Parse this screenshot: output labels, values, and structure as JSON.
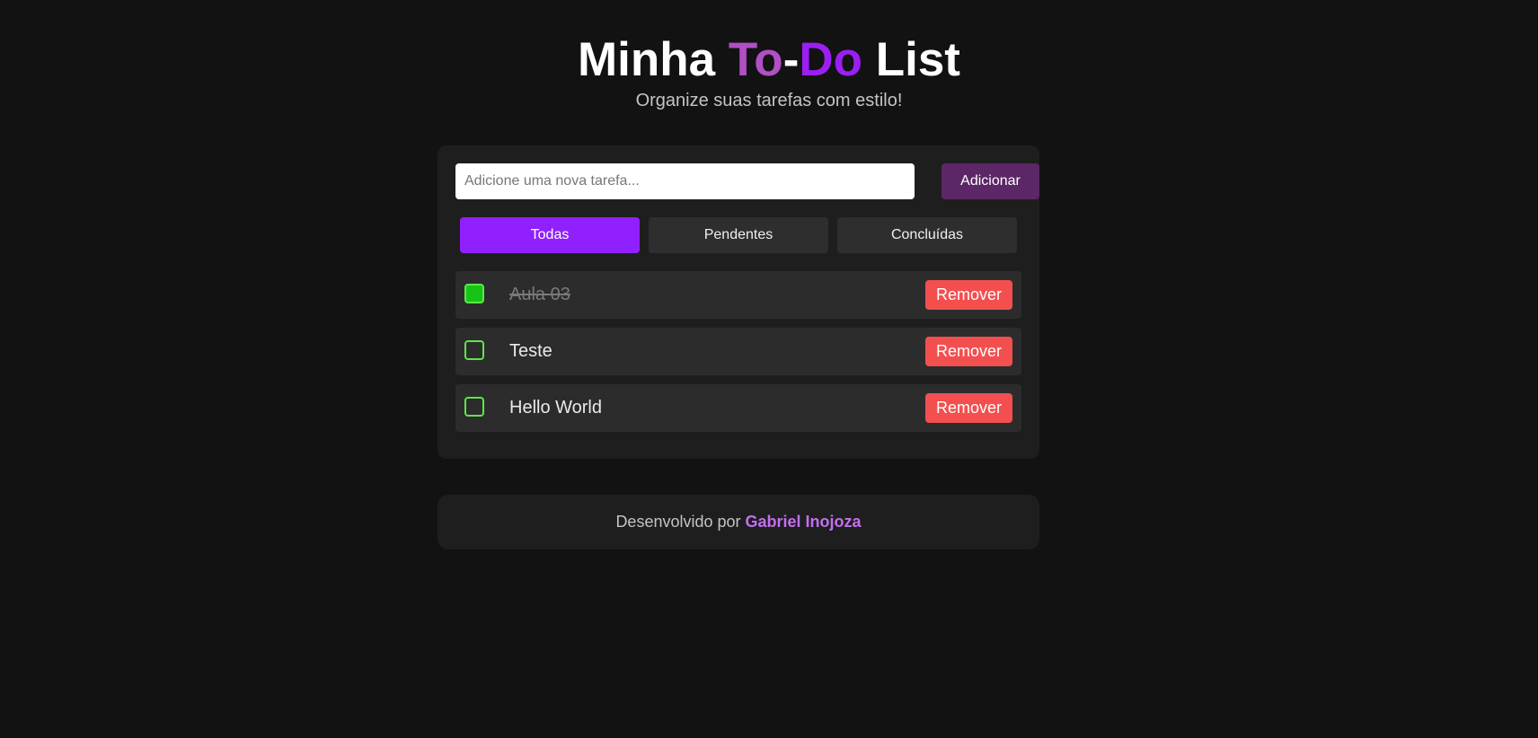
{
  "header": {
    "title_part1": "Minha ",
    "title_to": "To",
    "title_dash": "-",
    "title_do": "Do",
    "title_part2": " List",
    "subtitle": "Organize suas tarefas com estilo!"
  },
  "input": {
    "value": "",
    "placeholder": "Adicione uma nova tarefa...",
    "add_label": "Adicionar"
  },
  "filters": {
    "items": [
      {
        "label": "Todas",
        "active": true
      },
      {
        "label": "Pendentes",
        "active": false
      },
      {
        "label": "Concluídas",
        "active": false
      }
    ]
  },
  "tasks": [
    {
      "text": "Aula 03",
      "done": true,
      "remove_label": "Remover"
    },
    {
      "text": "Teste",
      "done": false,
      "remove_label": "Remover"
    },
    {
      "text": "Hello World",
      "done": false,
      "remove_label": "Remover"
    }
  ],
  "footer": {
    "prefix": "Desenvolvido por ",
    "author": "Gabriel Inojoza"
  },
  "colors": {
    "background": "#121212",
    "card": "#1e1e1e",
    "accent_purple": "#9120ff",
    "add_button": "#5c2766",
    "remove_button": "#f34f4f",
    "checkbox_border": "#5ce64a",
    "checkbox_checked": "#16c416",
    "author": "#c36ff0"
  }
}
